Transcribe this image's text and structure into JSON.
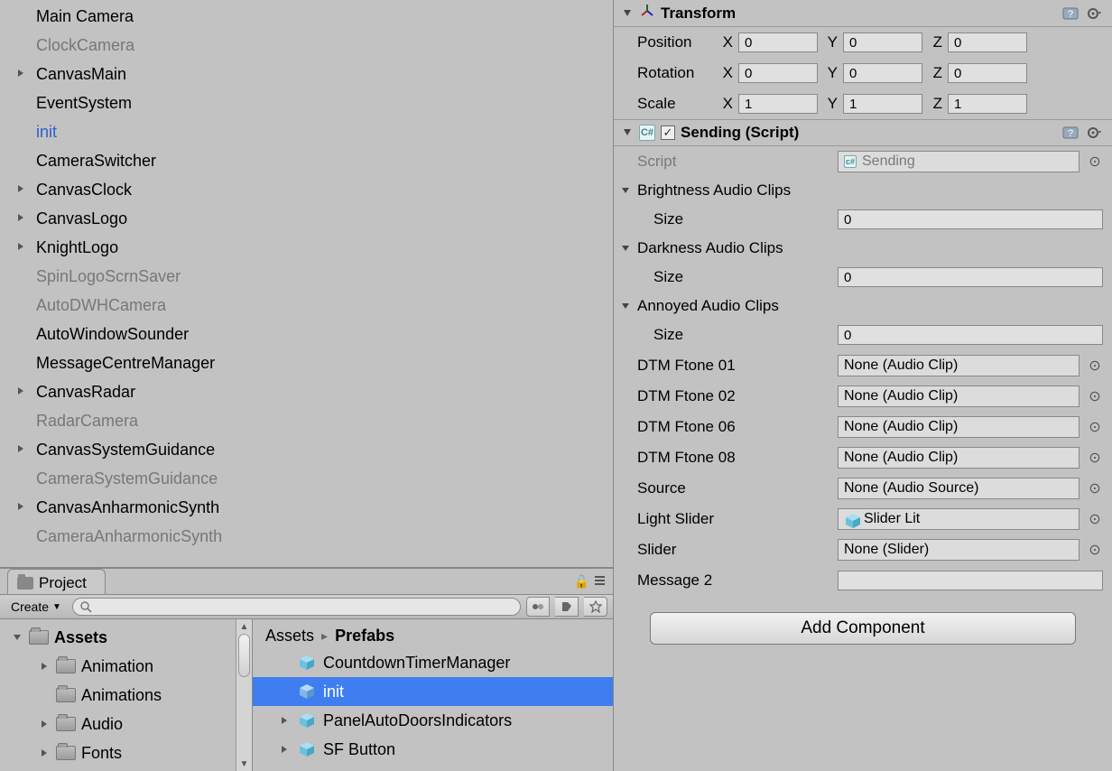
{
  "hierarchy": {
    "items": [
      {
        "label": "Main Camera",
        "expand": false,
        "dim": false,
        "sel": false
      },
      {
        "label": "ClockCamera",
        "expand": false,
        "dim": true,
        "sel": false
      },
      {
        "label": "CanvasMain",
        "expand": true,
        "dim": false,
        "sel": false
      },
      {
        "label": "EventSystem",
        "expand": false,
        "dim": false,
        "sel": false
      },
      {
        "label": "init",
        "expand": false,
        "dim": false,
        "sel": true
      },
      {
        "label": "CameraSwitcher",
        "expand": false,
        "dim": false,
        "sel": false
      },
      {
        "label": "CanvasClock",
        "expand": true,
        "dim": false,
        "sel": false
      },
      {
        "label": "CanvasLogo",
        "expand": true,
        "dim": false,
        "sel": false
      },
      {
        "label": "KnightLogo",
        "expand": true,
        "dim": false,
        "sel": false
      },
      {
        "label": "SpinLogoScrnSaver",
        "expand": false,
        "dim": true,
        "sel": false
      },
      {
        "label": "AutoDWHCamera",
        "expand": false,
        "dim": true,
        "sel": false
      },
      {
        "label": "AutoWindowSounder",
        "expand": false,
        "dim": false,
        "sel": false
      },
      {
        "label": "MessageCentreManager",
        "expand": false,
        "dim": false,
        "sel": false
      },
      {
        "label": "CanvasRadar",
        "expand": true,
        "dim": false,
        "sel": false
      },
      {
        "label": "RadarCamera",
        "expand": false,
        "dim": true,
        "sel": false
      },
      {
        "label": "CanvasSystemGuidance",
        "expand": true,
        "dim": false,
        "sel": false
      },
      {
        "label": "CameraSystemGuidance",
        "expand": false,
        "dim": true,
        "sel": false
      },
      {
        "label": "CanvasAnharmonicSynth",
        "expand": true,
        "dim": false,
        "sel": false
      },
      {
        "label": "CameraAnharmonicSynth",
        "expand": false,
        "dim": true,
        "sel": false
      }
    ]
  },
  "project": {
    "tab_label": "Project",
    "create_label": "Create",
    "search_placeholder": "",
    "tree": {
      "root": "Assets",
      "children": [
        "Animation",
        "Animations",
        "Audio",
        "Fonts"
      ]
    },
    "breadcrumbs": {
      "root": "Assets",
      "current": "Prefabs"
    },
    "list": [
      {
        "label": "CountdownTimerManager",
        "sel": false,
        "exp": false
      },
      {
        "label": "init",
        "sel": true,
        "exp": false
      },
      {
        "label": "PanelAutoDoorsIndicators",
        "sel": false,
        "exp": true
      },
      {
        "label": "SF Button",
        "sel": false,
        "exp": true
      }
    ]
  },
  "inspector": {
    "transform": {
      "title": "Transform",
      "position": {
        "label": "Position",
        "x": "0",
        "y": "0",
        "z": "0"
      },
      "rotation": {
        "label": "Rotation",
        "x": "0",
        "y": "0",
        "z": "0"
      },
      "scale": {
        "label": "Scale",
        "x": "1",
        "y": "1",
        "z": "1"
      },
      "axis": {
        "x": "X",
        "y": "Y",
        "z": "Z"
      }
    },
    "sending": {
      "title": "Sending (Script)",
      "script_label": "Script",
      "script_value": "Sending",
      "sections": [
        {
          "title": "Brightness Audio Clips",
          "size_label": "Size",
          "size": "0"
        },
        {
          "title": "Darkness Audio Clips",
          "size_label": "Size",
          "size": "0"
        },
        {
          "title": "Annoyed Audio Clips",
          "size_label": "Size",
          "size": "0"
        }
      ],
      "fields": [
        {
          "label": "DTM Ftone 01",
          "value": "None (Audio Clip)",
          "picker": true
        },
        {
          "label": "DTM Ftone 02",
          "value": "None (Audio Clip)",
          "picker": true
        },
        {
          "label": "DTM Ftone 06",
          "value": "None (Audio Clip)",
          "picker": true
        },
        {
          "label": "DTM Ftone 08",
          "value": "None (Audio Clip)",
          "picker": true
        },
        {
          "label": "Source",
          "value": "None (Audio Source)",
          "picker": true
        },
        {
          "label": "Light Slider",
          "value": "Slider Lit",
          "picker": true,
          "cube": true
        },
        {
          "label": "Slider",
          "value": "None (Slider)",
          "picker": true
        },
        {
          "label": "Message 2",
          "value": "",
          "text": true
        }
      ]
    },
    "add_component": "Add Component"
  }
}
